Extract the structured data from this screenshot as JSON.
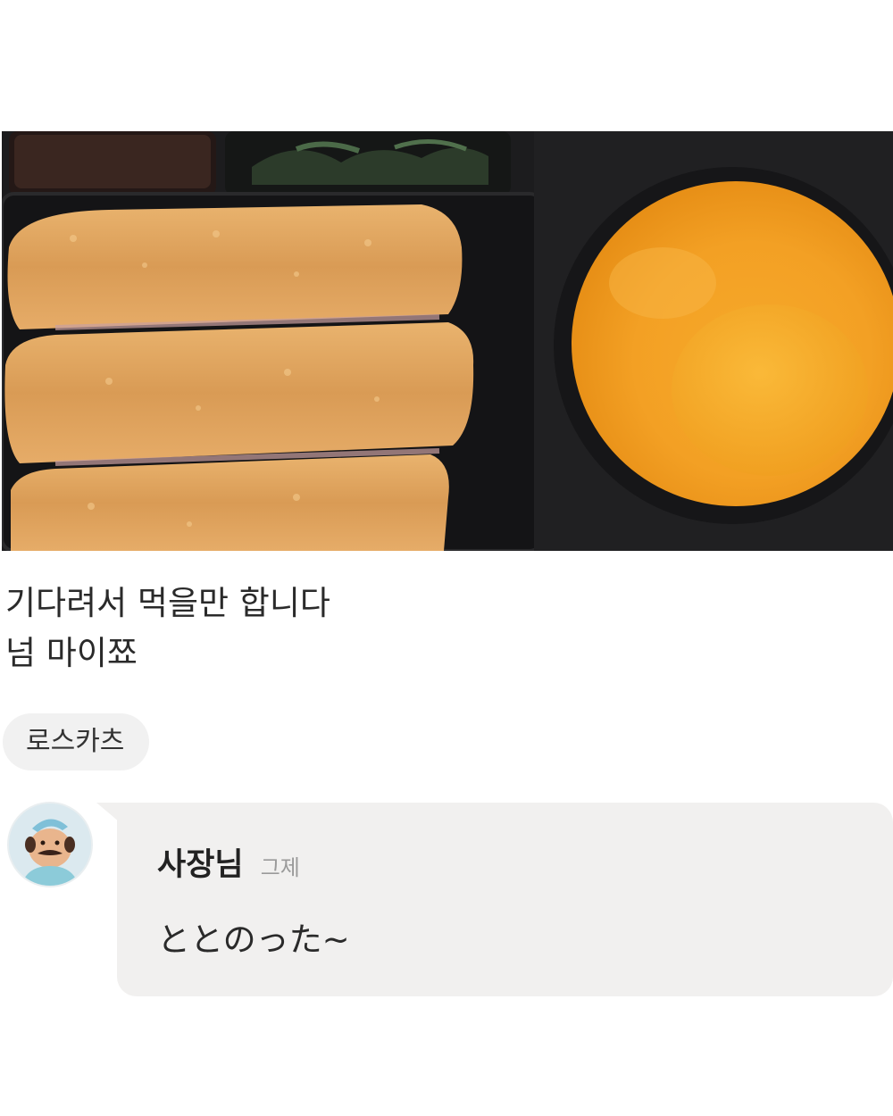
{
  "review": {
    "photo_label": "food-photo",
    "lines": [
      "기다려서 먹을만 합니다",
      "넘 마이쬬"
    ],
    "menu_tag": "로스카츠"
  },
  "owner_reply": {
    "name": "사장님",
    "time": "그제",
    "text": "ととのった~"
  },
  "colors": {
    "background": "#ffffff",
    "tag_bg": "#f1f1f1",
    "bubble_bg": "#f1f0ef",
    "time_text": "#9a9a9a"
  },
  "icons": {
    "avatar": "owner-avatar"
  }
}
